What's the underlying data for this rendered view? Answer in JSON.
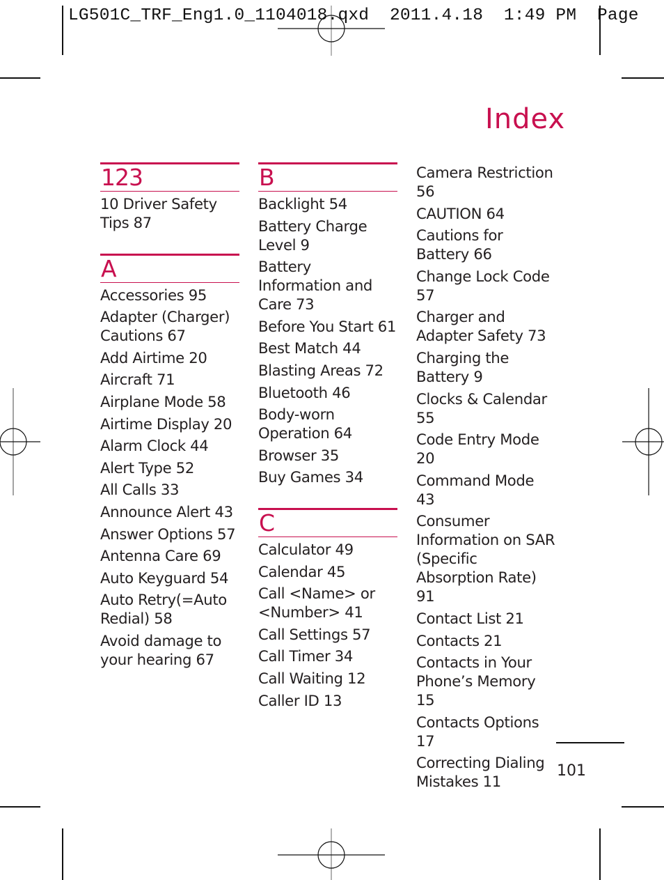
{
  "slug": {
    "text": "LG501C_TRF_Eng1.0_1104018.qxd  2011.4.18  1:49 PM  Page"
  },
  "title": "Index",
  "columns": [
    {
      "sections": [
        {
          "heading": "123",
          "entries": [
            "10 Driver Safety Tips 87"
          ]
        },
        {
          "heading": "A",
          "entries": [
            "Accessories 95",
            "Adapter (Charger) Cautions 67",
            "Add Airtime 20",
            "Aircraft 71",
            "Airplane Mode 58",
            "Airtime Display 20",
            "Alarm Clock 44",
            "Alert Type 52",
            "All Calls 33",
            "Announce Alert 43",
            "Answer Options 57",
            "Antenna Care 69",
            "Auto Keyguard 54",
            "Auto Retry(=Auto Redial) 58",
            "Avoid damage to your hearing 67"
          ]
        }
      ]
    },
    {
      "sections": [
        {
          "heading": "B",
          "entries": [
            "Backlight 54",
            "Battery Charge Level 9",
            "Battery Information and Care 73",
            "Before You Start 61",
            "Best Match 44",
            "Blasting Areas 72",
            "Bluetooth 46",
            "Body-worn Operation 64",
            "Browser 35",
            "Buy Games 34"
          ]
        },
        {
          "heading": "C",
          "entries": [
            "Calculator 49",
            "Calendar 45",
            "Call <Name> or <Number> 41",
            "Call Settings 57",
            "Call Timer 34",
            "Call Waiting 12",
            "Caller ID 13"
          ]
        }
      ]
    },
    {
      "sections": [
        {
          "heading": "",
          "entries": [
            "Camera Restriction 56",
            "CAUTION 64",
            "Cautions for Battery 66",
            "Change Lock Code 57",
            "Charger and Adapter Safety 73",
            "Charging the Battery 9",
            "Clocks & Calendar 55",
            "Code Entry Mode 20",
            "Command Mode 43",
            "Consumer Information on SAR (Specific Absorption Rate) 91",
            "Contact List 21",
            "Contacts 21",
            "Contacts in Your Phone’s Memory 15",
            "Contacts Options 17",
            "Correcting Dialing Mistakes 11"
          ]
        }
      ]
    }
  ],
  "page_number": "101",
  "colors": {
    "accent": "#c8104f",
    "text": "#231f20"
  }
}
